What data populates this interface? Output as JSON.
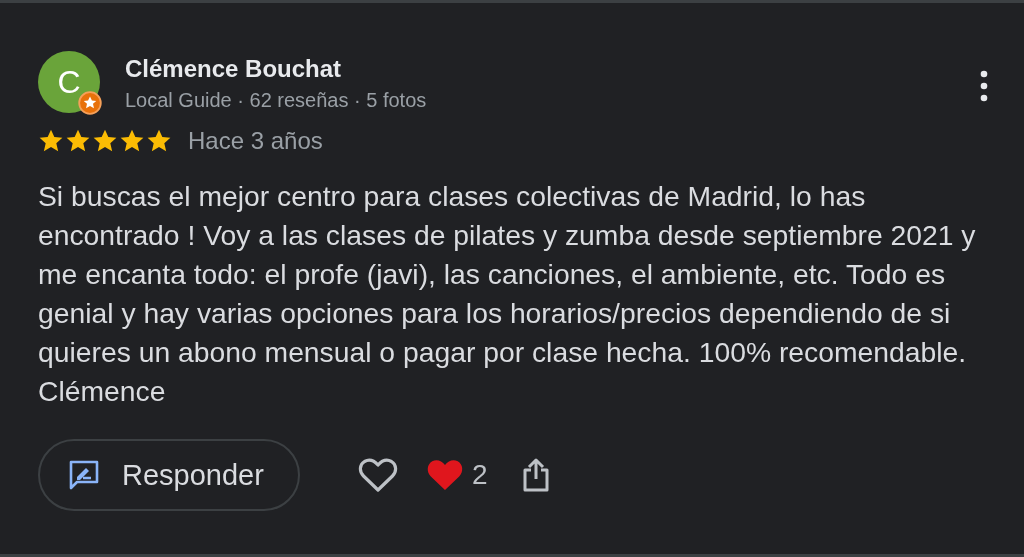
{
  "review": {
    "avatar_letter": "C",
    "author": "Clémence Bouchat",
    "author_meta": "Local Guide · 62 reseñas · 5 fotos",
    "stars": 5,
    "time": "Hace 3 años",
    "text": "Si buscas el mejor centro para clases colectivas de Madrid, lo has encontrado ! Voy a las clases de pilates y zumba desde septiembre 2021 y me encanta todo: el profe (javi), las canciones, el ambiente, etc. Todo es genial y hay varias opciones para los horarios/precios dependiendo de si quieres un abono mensual o pagar por clase hecha. 100% recomendable. Clémence",
    "reply_button": "Responder",
    "reaction_count": "2"
  }
}
